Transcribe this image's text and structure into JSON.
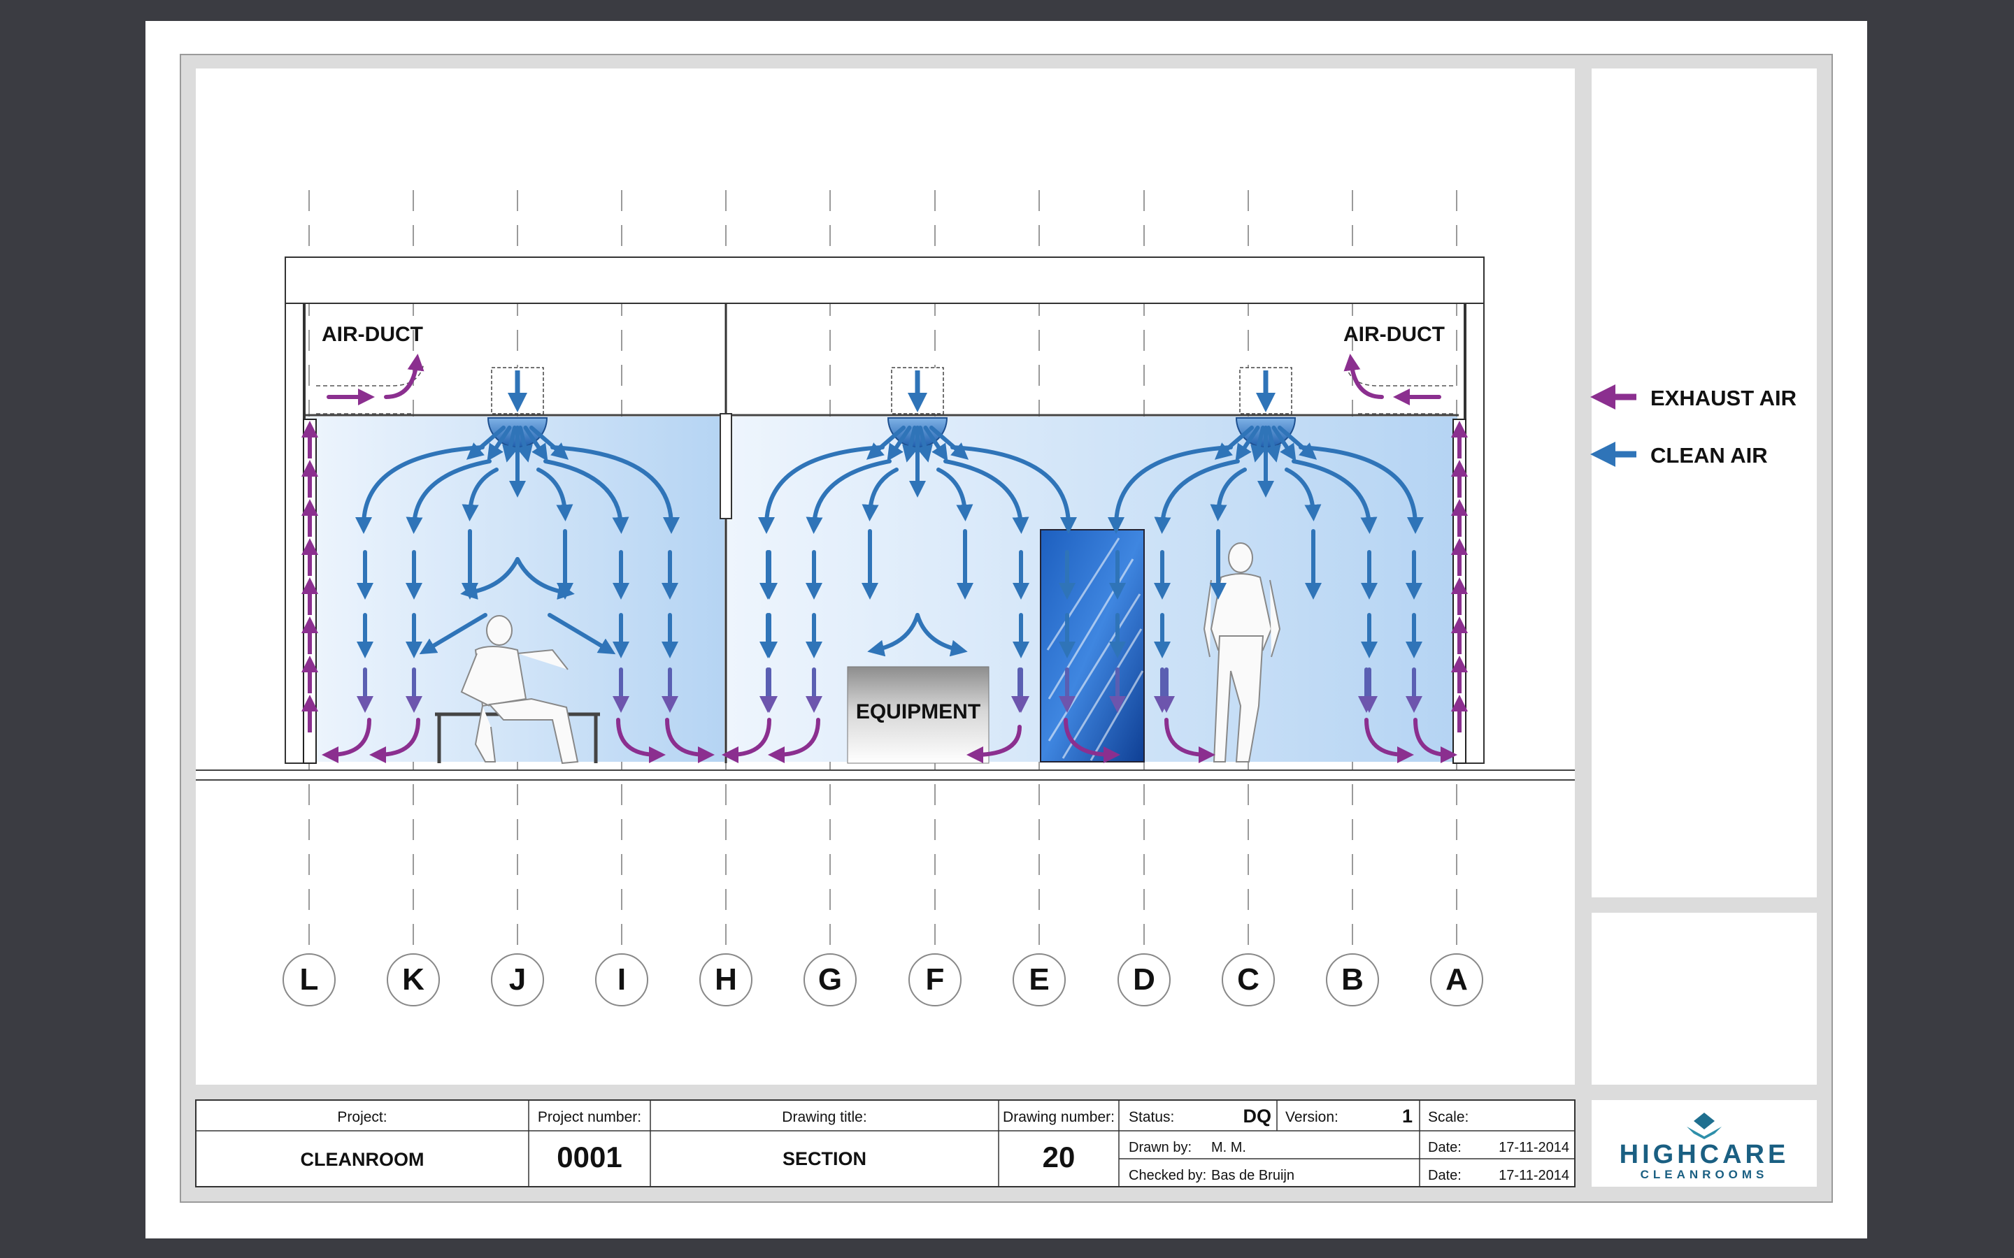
{
  "labels": {
    "air_duct_left": "AIR-DUCT",
    "air_duct_right": "AIR-DUCT",
    "equipment": "EQUIPMENT"
  },
  "legend": {
    "items": [
      {
        "label": "EXHAUST AIR",
        "color": "#8b2f8f"
      },
      {
        "label": "CLEAN AIR",
        "color": "#2f74b8"
      }
    ]
  },
  "gridlines": [
    "L",
    "K",
    "J",
    "I",
    "H",
    "G",
    "F",
    "E",
    "D",
    "C",
    "B",
    "A"
  ],
  "title_block": {
    "project_label": "Project:",
    "project_value": "CLEANROOM",
    "project_number_label": "Project number:",
    "project_number_value": "0001",
    "drawing_title_label": "Drawing title:",
    "drawing_title_value": "SECTION",
    "drawing_number_label": "Drawing number:",
    "drawing_number_value": "20",
    "status_label": "Status:",
    "status_value": "DQ",
    "version_label": "Version:",
    "version_value": "1",
    "scale_label": "Scale:",
    "drawn_by_label": "Drawn by:",
    "drawn_by_value": "M. M.",
    "checked_by_label": "Checked by:",
    "checked_by_value": "Bas de Bruijn",
    "date_label_1": "Date:",
    "date_value_1": "17-11-2014",
    "date_label_2": "Date:",
    "date_value_2": "17-11-2014"
  },
  "logo": {
    "line1": "HIGHCARE",
    "line2": "CLEANROOMS"
  },
  "colors": {
    "clean_air": "#2f74b8",
    "exhaust_air": "#8b2f8f",
    "room_fill": "#cfe3f8",
    "background": "#3b3c42"
  }
}
